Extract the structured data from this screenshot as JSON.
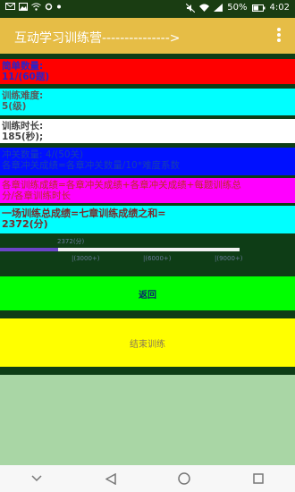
{
  "status_bar": {
    "time": "4:02",
    "battery": "50%"
  },
  "app_bar": {
    "title": "互动学习训练营--------------->"
  },
  "stats": {
    "question_count_label": "简单数量:",
    "question_count_value": "11/(60题)",
    "difficulty_label": "训练难度:",
    "difficulty_value": "5(级)",
    "duration_label": "训练时长:",
    "duration_value": "185(秒);",
    "blue_line1": "冲关数量: 4/(50关)",
    "blue_line2": "各章冲关成绩=各章冲关数量/10*难度系数",
    "formula_line1": "各章训练成绩=各章冲关成绩+各章冲关成绩+每题训练总",
    "formula_line2": "分/各章训练时长",
    "total_line1": "一场训练总成绩=七章训练成绩之和=",
    "total_line2": "2372(分)"
  },
  "progress": {
    "current_label": "2372(分)",
    "fraction": 0.243,
    "tick_1": "|(3000+)",
    "tick_2": "|(6000+)",
    "tick_3": "|(9000+)"
  },
  "buttons": {
    "return_label": "返回",
    "end_label": "结束训练"
  },
  "colors": {
    "app_bar": "#e6bd46",
    "progress_fill": "#6b45c8"
  }
}
